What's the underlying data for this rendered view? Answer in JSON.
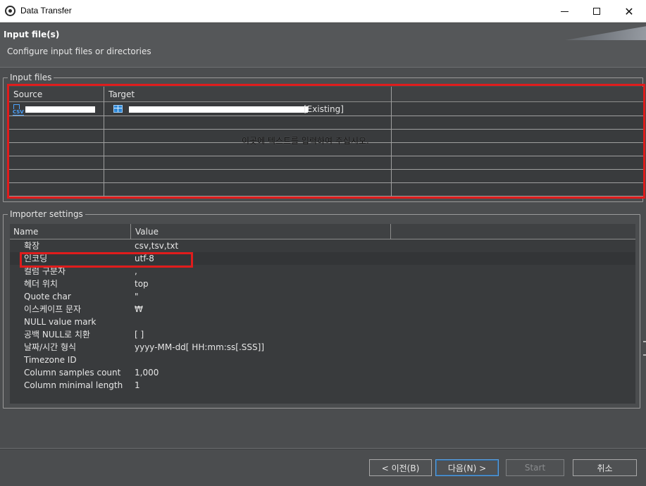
{
  "window": {
    "title": "Data Transfer",
    "minimize_glyph": "",
    "close_glyph": "✕"
  },
  "header": {
    "title": "Input file(s)",
    "subtitle": "Configure input files or directories"
  },
  "input_files": {
    "group_label": "Input files",
    "columns": [
      "Source",
      "Target",
      ""
    ],
    "rows": [
      {
        "source_icon": "csv-file-icon",
        "target_icon": "table-icon",
        "target_suffix": "[Existing]"
      }
    ],
    "hint": "이곳에 텍스트를 입력하여 주십시오."
  },
  "importer_settings": {
    "group_label": "Importer settings",
    "columns": [
      "Name",
      "Value",
      ""
    ],
    "rows": [
      {
        "name": "확장",
        "value": "csv,tsv,txt"
      },
      {
        "name": "인코딩",
        "value": "utf-8"
      },
      {
        "name": "컬럼 구분자",
        "value": ","
      },
      {
        "name": "헤더 위치",
        "value": "top"
      },
      {
        "name": "Quote char",
        "value": "\""
      },
      {
        "name": "이스케이프 문자",
        "value": "₩"
      },
      {
        "name": "NULL value mark",
        "value": ""
      },
      {
        "name": "공백 NULL로 치환",
        "value": "[ ]"
      },
      {
        "name": "날짜/시간 형식",
        "value": "yyyy-MM-dd[ HH:mm:ss[.SSS]]"
      },
      {
        "name": "Timezone ID",
        "value": ""
      },
      {
        "name": "Column samples count",
        "value": "1,000"
      },
      {
        "name": "Column minimal length",
        "value": "1"
      }
    ]
  },
  "footer": {
    "back_label": "< 이전(B)",
    "next_label": "다음(N) >",
    "start_label": "Start",
    "cancel_label": "취소"
  },
  "colors": {
    "highlight_red": "#e01c1c",
    "primary_border": "#5aa0e0"
  }
}
